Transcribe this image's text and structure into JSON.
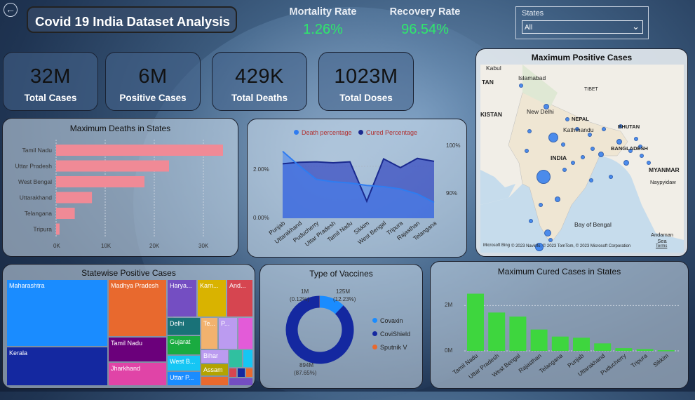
{
  "header": {
    "title": "Covid 19 India Dataset Analysis",
    "mortality_label": "Mortality Rate",
    "mortality_value": "1.26%",
    "recovery_label": "Recovery Rate",
    "recovery_value": "96.54%"
  },
  "filter": {
    "label": "States",
    "value": "All"
  },
  "kpis": [
    {
      "value": "32M",
      "label": "Total Cases"
    },
    {
      "value": "6M",
      "label": "Positive Cases"
    },
    {
      "value": "429K",
      "label": "Total Deaths"
    },
    {
      "value": "1023M",
      "label": "Total Doses"
    }
  ],
  "deaths_chart": {
    "title": "Maximum Deaths in States",
    "ticks": [
      "0K",
      "10K",
      "20K",
      "30K"
    ]
  },
  "perc_chart": {
    "legend1": "Death percentage",
    "legend2": "Cured Percentage",
    "y_left": [
      "2.00%",
      "0.00%"
    ],
    "y_right": [
      "100%",
      "90%"
    ]
  },
  "map": {
    "title": "Maximum Positive Cases",
    "labels": [
      "Kabul",
      "Islamabad",
      "TAN",
      "TIBET",
      "KISTAN",
      "New Delhi",
      "NEPAL",
      "Kathmandu",
      "BHUTAN",
      "BANGLADESH",
      "INDIA",
      "MYANMAR",
      "Naypyidaw",
      "Bay of Bengal",
      "Andaman Sea"
    ],
    "attribution": "© 2023 Navinfo, © 2023 TomTom, © 2023 Microsoft Corporation",
    "terms": "Terms",
    "brand": "Microsoft Bing"
  },
  "treemap": {
    "title": "Statewise Positive Cases",
    "cells": [
      "Maharashtra",
      "Kerala",
      "Madhya Pradesh",
      "Tamil Nadu",
      "Jharkhand",
      "Harya...",
      "Karn...",
      "And...",
      "Delhi",
      "Te...",
      "P...",
      "Gujarat",
      "Bihar",
      "West B...",
      "Assam",
      "Uttar P..."
    ]
  },
  "vaccines": {
    "title": "Type of Vaccines",
    "lbl_1m": "1M",
    "lbl_1m_pct": "(0.12%)",
    "lbl_125m": "125M",
    "lbl_125m_pct": "(12.23%)",
    "lbl_894m": "894M",
    "lbl_894m_pct": "(87.65%)",
    "legend": [
      "Covaxin",
      "CoviShield",
      "Sputnik V"
    ]
  },
  "cured_chart": {
    "title": "Maximum Cured Cases in States",
    "y_ticks": [
      "2M",
      "0M"
    ]
  },
  "chart_data": [
    {
      "type": "bar",
      "title": "Maximum Deaths in States",
      "categories": [
        "Tamil Nadu",
        "Uttar Pradesh",
        "West Bengal",
        "Uttarakhand",
        "Telangana",
        "Tripura"
      ],
      "values": [
        34000,
        23000,
        18000,
        7300,
        3800,
        700
      ],
      "xlim": [
        0,
        35000
      ],
      "color": "#f08a96"
    },
    {
      "type": "area",
      "categories": [
        "Punjab",
        "Uttarakhand",
        "Puducherry",
        "Uttar Pradesh",
        "Tamil Nadu",
        "Sikkim",
        "West Bengal",
        "Tripura",
        "Rajasthan",
        "Telangana"
      ],
      "series": [
        {
          "name": "Death percentage",
          "values": [
            2.75,
            2.15,
            1.6,
            1.5,
            1.45,
            1.35,
            1.3,
            1.2,
            1.0,
            0.65
          ],
          "ylim": [
            0,
            3
          ],
          "color": "#2f7cf0"
        },
        {
          "name": "Cured Percentage",
          "values": [
            97.2,
            97.5,
            97.6,
            97.4,
            97.6,
            89.5,
            98.2,
            96.4,
            98.3,
            97.7
          ],
          "ylim": [
            86,
            101
          ],
          "color": "#1a2a8f"
        }
      ]
    },
    {
      "type": "table",
      "title": "Statewise Positive Cases",
      "categories": [
        "Maharashtra",
        "Kerala",
        "Madhya Pradesh",
        "Tamil Nadu",
        "Jharkhand"
      ]
    },
    {
      "type": "pie",
      "title": "Type of Vaccines",
      "categories": [
        "Covaxin",
        "CoviShield",
        "Sputnik V"
      ],
      "values": [
        125,
        894,
        1
      ],
      "colors": [
        "#1a8cff",
        "#1428a0",
        "#e8692e"
      ]
    },
    {
      "type": "bar",
      "title": "Maximum Cured Cases in States",
      "categories": [
        "Tamil Nadu",
        "Uttar Pradesh",
        "West Bengal",
        "Rajasthan",
        "Telangana",
        "Punjab",
        "Uttarakhand",
        "Puducherry",
        "Tripura",
        "Sikkim"
      ],
      "values": [
        2520000,
        1690000,
        1510000,
        940000,
        630000,
        580000,
        330000,
        120000,
        80000,
        30000
      ],
      "ylim": [
        0,
        3000000
      ],
      "color": "#3ed63e"
    }
  ],
  "colors": {
    "green_kpi": "#2ee86b",
    "treemap": [
      "#1a8cff",
      "#1428a0",
      "#e8692e",
      "#6b007b",
      "#e044a7",
      "#744ec2",
      "#d9b300",
      "#d64550",
      "#197278",
      "#1aab40",
      "#15c6f4",
      "#f2b26e",
      "#bb9bf0",
      "#b3a300"
    ]
  }
}
